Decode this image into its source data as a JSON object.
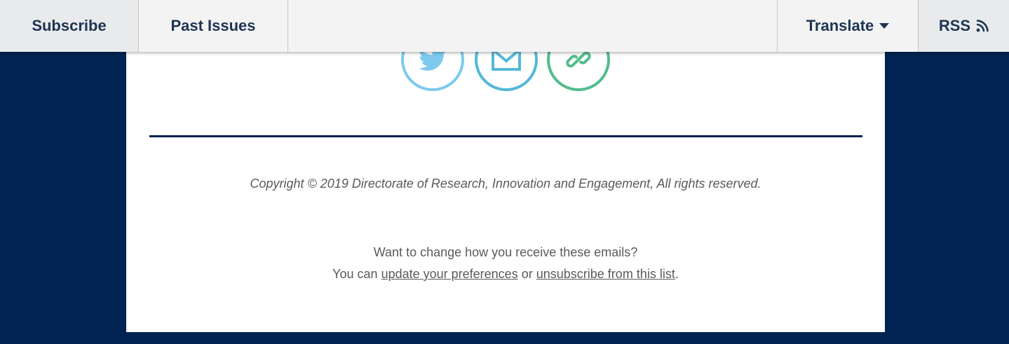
{
  "nav": {
    "subscribe": "Subscribe",
    "past_issues": "Past Issues",
    "translate": "Translate",
    "rss": "RSS"
  },
  "social": [
    {
      "name": "twitter-icon",
      "color": "#7dcaee"
    },
    {
      "name": "email-icon",
      "color": "#55b8d8"
    },
    {
      "name": "link-icon",
      "color": "#52bc8c"
    }
  ],
  "footer": {
    "copyright": "Copyright © 2019 Directorate of Research, Innovation and Engagement, All rights reserved.",
    "change_prompt": "Want to change how you receive these emails?",
    "you_can": "You can",
    "update_link": "update your preferences",
    "or": "or",
    "unsubscribe_link": "unsubscribe from this list",
    "period": "."
  },
  "colors": {
    "background": "#012351",
    "card": "#ffffff",
    "text": "#5a5a5a",
    "nav_text": "#1d3552"
  }
}
